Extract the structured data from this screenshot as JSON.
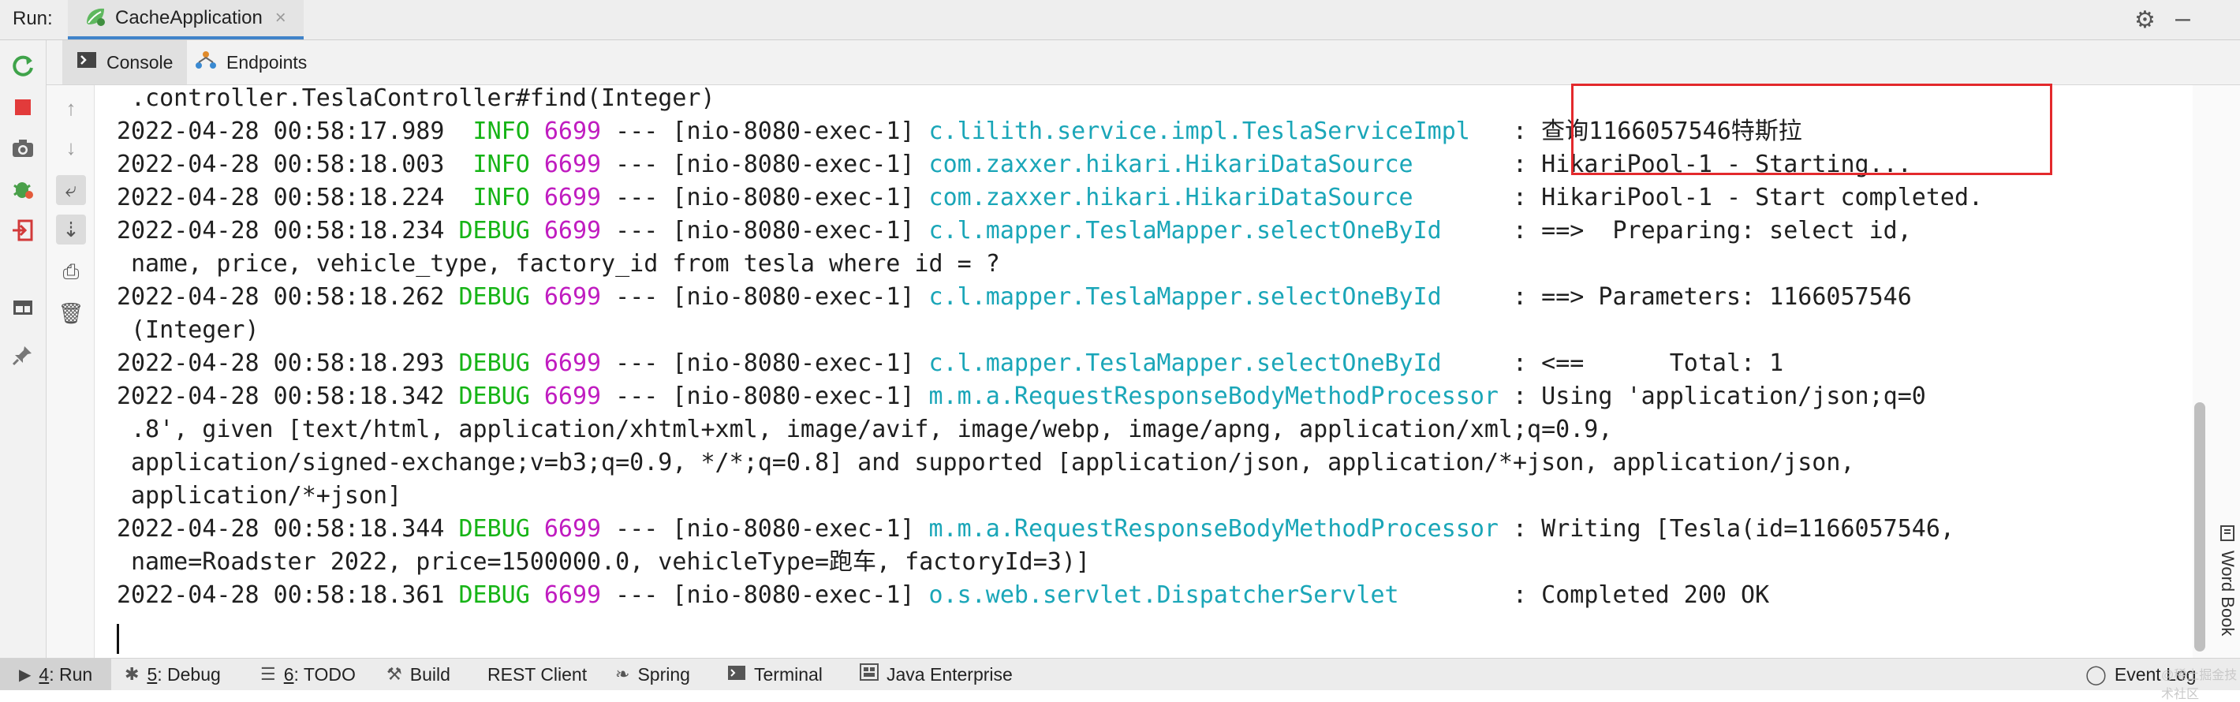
{
  "header": {
    "run_label": "Run:",
    "tab_title": "CacheApplication",
    "close_glyph": "×",
    "icons": [
      "spring-leaf-icon",
      "gear-icon",
      "minimize-icon"
    ]
  },
  "subtabs": {
    "console": "Console",
    "endpoints": "Endpoints"
  },
  "console": {
    "lines": [
      ".controller.TeslaController#find(Integer)",
      "2022-04-28 00:58:17.989  INFO 6699 --- [nio-8080-exec-1] c.lilith.service.impl.TeslaServiceImpl   : 查询1166057546特斯拉",
      "2022-04-28 00:58:18.003  INFO 6699 --- [nio-8080-exec-1] com.zaxxer.hikari.HikariDataSource       : HikariPool-1 - Starting...",
      "2022-04-28 00:58:18.224  INFO 6699 --- [nio-8080-exec-1] com.zaxxer.hikari.HikariDataSource       : HikariPool-1 - Start completed.",
      "2022-04-28 00:58:18.234 DEBUG 6699 --- [nio-8080-exec-1] c.l.mapper.TeslaMapper.selectOneById     : ==>  Preparing: select id,",
      "name, price, vehicle_type, factory_id from tesla where id = ?",
      "2022-04-28 00:58:18.262 DEBUG 6699 --- [nio-8080-exec-1] c.l.mapper.TeslaMapper.selectOneById     : ==> Parameters: 1166057546",
      "(Integer)",
      "2022-04-28 00:58:18.293 DEBUG 6699 --- [nio-8080-exec-1] c.l.mapper.TeslaMapper.selectOneById     : <==      Total: 1",
      "2022-04-28 00:58:18.342 DEBUG 6699 --- [nio-8080-exec-1] m.m.a.RequestResponseBodyMethodProcessor : Using 'application/json;q=0",
      ".8', given [text/html, application/xhtml+xml, image/avif, image/webp, image/apng, application/xml;q=0.9,",
      "application/signed-exchange;v=b3;q=0.9, */*;q=0.8] and supported [application/json, application/*+json, application/json,",
      "application/*+json]",
      "2022-04-28 00:58:18.344 DEBUG 6699 --- [nio-8080-exec-1] m.m.a.RequestResponseBodyMethodProcessor : Writing [Tesla(id=1166057546,",
      "name=Roadster 2022, price=1500000.0, vehicleType=跑车, factoryId=3)]",
      "2022-04-28 00:58:18.361 DEBUG 6699 --- [nio-8080-exec-1] o.s.web.servlet.DispatcherServlet        : Completed 200 OK"
    ]
  },
  "sidebar_right": {
    "wordbook": "Word Book"
  },
  "bottom_bar": {
    "run": {
      "num": "4",
      "text": ": Run"
    },
    "debug": {
      "num": "5",
      "text": ": Debug"
    },
    "todo": {
      "num": "6",
      "text": ": TODO"
    },
    "build": "Build",
    "rest_client": "REST Client",
    "spring": "Spring",
    "terminal": "Terminal",
    "java_enterprise": "Java Enterprise",
    "event_log": "Event Log"
  },
  "watermark": "@稀土掘金技术社区",
  "colors": {
    "info": "#16b416",
    "debug": "#16b416",
    "pid": "#c01cc0",
    "logger": "#1aa6b8",
    "highlight_box": "#e3292c",
    "tab_underline": "#4083c9"
  }
}
